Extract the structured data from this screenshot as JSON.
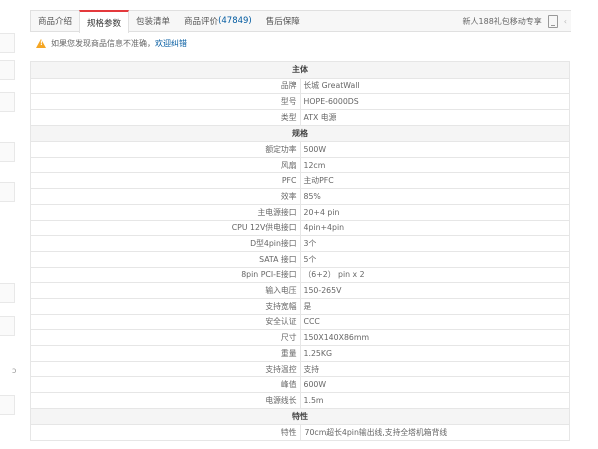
{
  "tabs": [
    {
      "label": "商品介绍",
      "count": null
    },
    {
      "label": "规格参数",
      "count": null
    },
    {
      "label": "包装清单",
      "count": null
    },
    {
      "label": "商品评价",
      "count": "(47849)"
    },
    {
      "label": "售后保障",
      "count": null
    }
  ],
  "promo": {
    "text": "新人188礼包移动专享"
  },
  "notice": {
    "text": "如果您发现商品信息不准确，",
    "link": "欢迎纠错"
  },
  "sections": [
    {
      "title": "主体",
      "rows": [
        {
          "key": "品牌",
          "value": "长城 GreatWall"
        },
        {
          "key": "型号",
          "value": "HOPE-6000DS"
        },
        {
          "key": "类型",
          "value": "ATX 电源"
        }
      ]
    },
    {
      "title": "规格",
      "rows": [
        {
          "key": "额定功率",
          "value": "500W"
        },
        {
          "key": "风扇",
          "value": "12cm"
        },
        {
          "key": "PFC",
          "value": "主动PFC"
        },
        {
          "key": "效率",
          "value": "85%"
        },
        {
          "key": "主电源接口",
          "value": "20+4 pin"
        },
        {
          "key": "CPU 12V供电接口",
          "value": "4pin+4pin"
        },
        {
          "key": "D型4pin接口",
          "value": "3个"
        },
        {
          "key": "SATA 接口",
          "value": "5个"
        },
        {
          "key": "8pin PCI-E接口",
          "value": "（6+2） pin x 2"
        },
        {
          "key": "输入电压",
          "value": "150-265V"
        },
        {
          "key": "支持宽幅",
          "value": "是"
        },
        {
          "key": "安全认证",
          "value": "CCC"
        },
        {
          "key": "尺寸",
          "value": "150X140X86mm"
        },
        {
          "key": "重量",
          "value": "1.25KG"
        },
        {
          "key": "支持温控",
          "value": "支持"
        },
        {
          "key": "峰值",
          "value": "600W"
        },
        {
          "key": "电源线长",
          "value": "1.5m"
        }
      ]
    },
    {
      "title": "特性",
      "rows": [
        {
          "key": "特性",
          "value": "70cm超长4pin输出线,支持全塔机箱背线"
        }
      ]
    }
  ],
  "colors": {
    "accent_red": "#e4393c",
    "link_blue": "#005aa0",
    "warning": "#f5a623"
  }
}
